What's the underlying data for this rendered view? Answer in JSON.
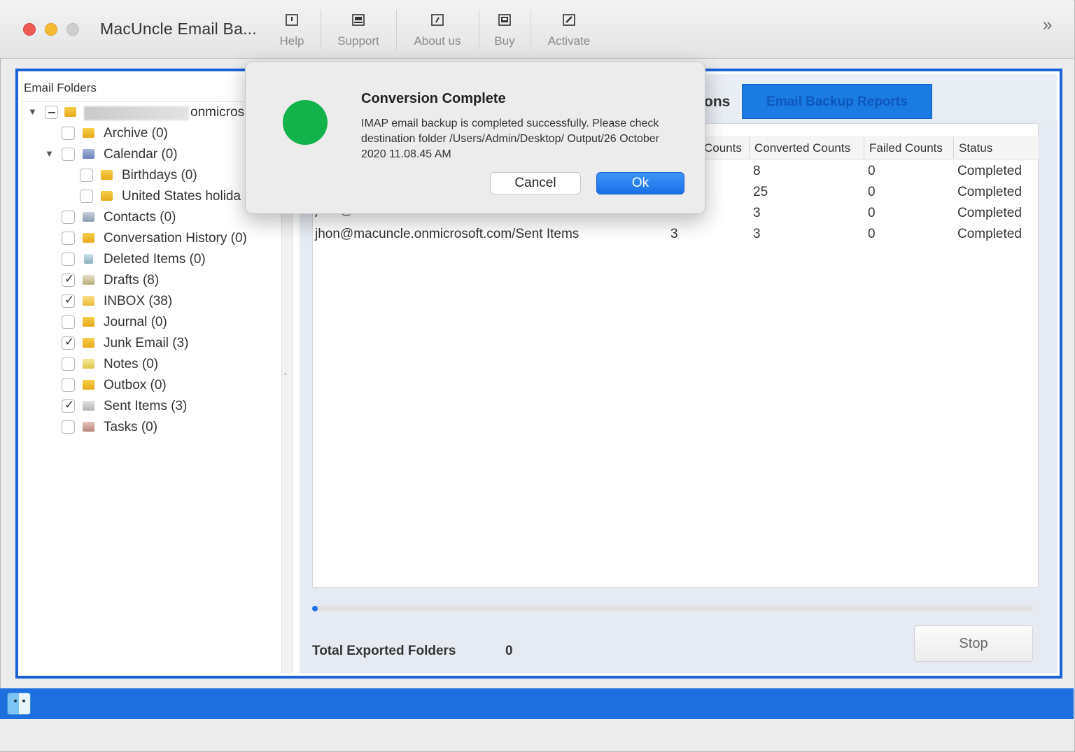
{
  "window": {
    "title": "MacUncle Email Ba...",
    "overflow_glyph": "»"
  },
  "toolbar": {
    "items": [
      {
        "label": "Help",
        "icon": "help-icon"
      },
      {
        "label": "Support",
        "icon": "support-icon"
      },
      {
        "label": "About us",
        "icon": "info-icon"
      },
      {
        "label": "Buy",
        "icon": "cart-icon"
      },
      {
        "label": "Activate",
        "icon": "key-icon"
      }
    ]
  },
  "sidebar": {
    "header": "Email Folders",
    "account_suffix": "onmicros",
    "folders": [
      {
        "label": "Archive (0)",
        "checked": false
      },
      {
        "label": "Calendar (0)",
        "checked": false
      },
      {
        "label": "Birthdays (0)",
        "checked": false
      },
      {
        "label": "United States holida",
        "checked": false
      },
      {
        "label": "Contacts (0)",
        "checked": false
      },
      {
        "label": "Conversation History (0)",
        "checked": false
      },
      {
        "label": "Deleted Items (0)",
        "checked": false
      },
      {
        "label": "Drafts (8)",
        "checked": true
      },
      {
        "label": "INBOX (38)",
        "checked": true
      },
      {
        "label": "Journal (0)",
        "checked": false
      },
      {
        "label": "Junk Email (3)",
        "checked": true
      },
      {
        "label": "Notes (0)",
        "checked": false
      },
      {
        "label": "Outbox (0)",
        "checked": false
      },
      {
        "label": "Sent Items (3)",
        "checked": true
      },
      {
        "label": "Tasks (0)",
        "checked": false
      }
    ]
  },
  "tabs": {
    "partial_label": "ons",
    "active_label": "Email Backup Reports"
  },
  "report": {
    "columns": [
      "Counts",
      "Converted Counts",
      "Failed Counts",
      "Status"
    ],
    "rows": [
      {
        "converted": "8",
        "failed": "0",
        "status": "Completed"
      },
      {
        "converted": "25",
        "failed": "0",
        "status": "Completed"
      },
      {
        "converted": "3",
        "failed": "0",
        "status": "Completed"
      },
      {
        "folder": "jhon@macuncle.onmicrosoft.com/Sent Items",
        "count": "3",
        "converted": "3",
        "failed": "0",
        "status": "Completed"
      }
    ],
    "partial_row": "jhon@macuncle.onmicrosoft.com/Junk Email"
  },
  "footer": {
    "total_label": "Total Exported Folders",
    "total_value": "0",
    "stop_label": "Stop",
    "progress": 0.0
  },
  "dialog": {
    "title": "Conversion Complete",
    "message": "IMAP email backup is completed successfully. Please check destination folder /Users/Admin/Desktop/ Output/26 October 2020 11.08.45 AM",
    "cancel_label": "Cancel",
    "ok_label": "Ok",
    "status_color": "#12b34a"
  },
  "colors": {
    "accent": "#1a62d6",
    "tab_active": "#1a7be3"
  }
}
